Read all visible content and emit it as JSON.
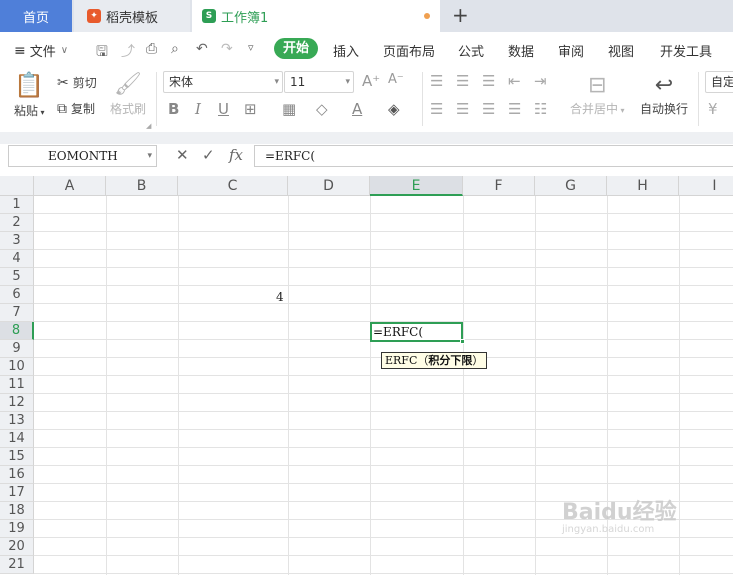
{
  "tabs": {
    "home": "首页",
    "template": "稻壳模板",
    "workbook": "工作簿1",
    "add": "+"
  },
  "menu": {
    "file": "文件",
    "start": "开始",
    "items": [
      "插入",
      "页面布局",
      "公式",
      "数据",
      "审阅",
      "视图",
      "开发工具"
    ]
  },
  "ribbon": {
    "paste": "粘贴",
    "cut": "剪切",
    "copy": "复制",
    "format_painter": "格式刷",
    "font_name": "宋体",
    "font_size": "11",
    "merge_center": "合并居中",
    "wrap_text": "自动换行",
    "auto_partial": "自定"
  },
  "formula_bar": {
    "name_box": "EOMONTH",
    "formula": "=ERFC("
  },
  "grid": {
    "columns": [
      "A",
      "B",
      "C",
      "D",
      "E",
      "F",
      "G",
      "H",
      "I"
    ],
    "rows": [
      "1",
      "2",
      "3",
      "4",
      "5",
      "6",
      "7",
      "8",
      "9",
      "10",
      "11",
      "12",
      "13",
      "14",
      "15",
      "16",
      "17",
      "18",
      "19",
      "20",
      "21"
    ],
    "active_column": "E",
    "active_row": "8",
    "cells": {
      "C6": "4",
      "E8": "=ERFC("
    }
  },
  "tooltip": {
    "func": "ERFC（",
    "arg": "积分下限",
    "close": "）"
  },
  "watermark": {
    "brand": "Baidu经验",
    "url": "jingyan.baidu.com"
  },
  "colors": {
    "accent_green": "#2e9e55",
    "home_tab_blue": "#4f7fd9"
  }
}
